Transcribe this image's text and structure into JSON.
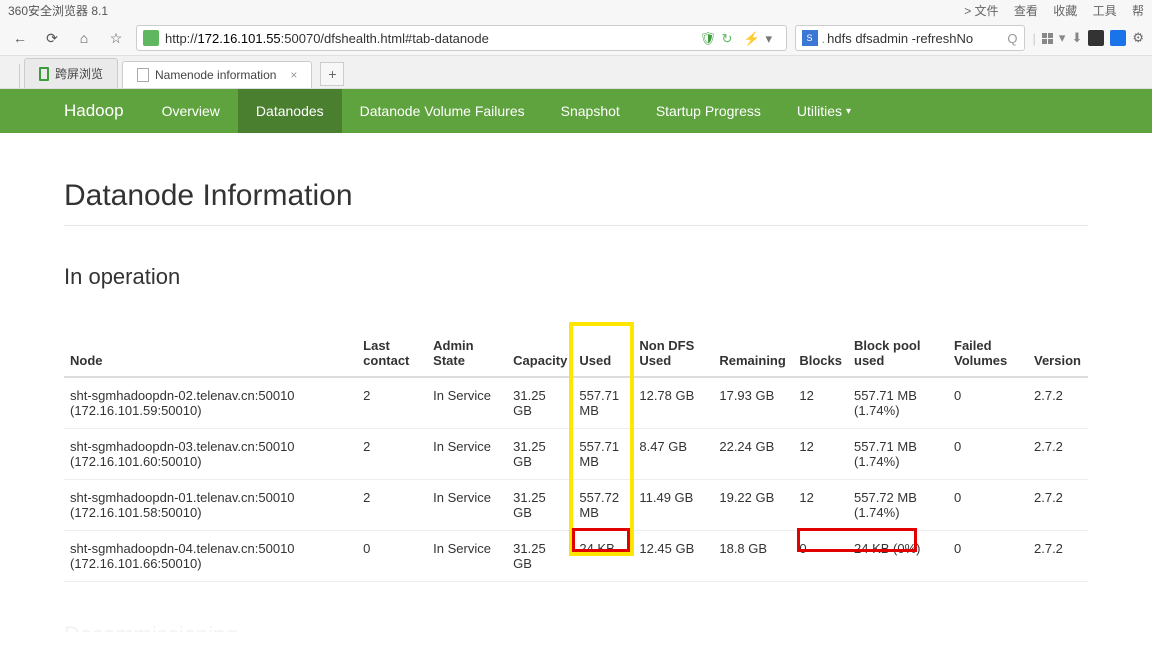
{
  "browser": {
    "title": "360安全浏览器 8.1",
    "right_menu": [
      "> 文件",
      "查看",
      "收藏",
      "工具",
      "帮"
    ],
    "url_prefix": "http://",
    "url_host": "172.16.101.55",
    "url_path": ":50070/dfshealth.html#tab-datanode",
    "search_value": "hdfs dfsadmin -refreshNo",
    "tabs": [
      {
        "label": "跨屏浏览",
        "type": "mobile"
      },
      {
        "label": "Namenode information",
        "type": "doc"
      }
    ]
  },
  "nav": {
    "brand": "Hadoop",
    "items": [
      {
        "label": "Overview",
        "active": false
      },
      {
        "label": "Datanodes",
        "active": true
      },
      {
        "label": "Datanode Volume Failures",
        "active": false
      },
      {
        "label": "Snapshot",
        "active": false
      },
      {
        "label": "Startup Progress",
        "active": false
      },
      {
        "label": "Utilities",
        "active": false,
        "dropdown": true
      }
    ]
  },
  "page": {
    "title": "Datanode Information",
    "section": "In operation",
    "section2": "Decommissioning"
  },
  "table": {
    "headers": [
      "Node",
      "Last contact",
      "Admin State",
      "Capacity",
      "Used",
      "Non DFS Used",
      "Remaining",
      "Blocks",
      "Block pool used",
      "Failed Volumes",
      "Version"
    ],
    "rows": [
      {
        "node": "sht-sgmhadoopdn-02.telenav.cn:50010",
        "node_sub": "(172.16.101.59:50010)",
        "last_contact": "2",
        "admin_state": "In Service",
        "capacity": "31.25 GB",
        "used": "557.71 MB",
        "non_dfs": "12.78 GB",
        "remaining": "17.93 GB",
        "blocks": "12",
        "block_pool": "557.71 MB (1.74%)",
        "failed": "0",
        "version": "2.7.2"
      },
      {
        "node": "sht-sgmhadoopdn-03.telenav.cn:50010",
        "node_sub": "(172.16.101.60:50010)",
        "last_contact": "2",
        "admin_state": "In Service",
        "capacity": "31.25 GB",
        "used": "557.71 MB",
        "non_dfs": "8.47 GB",
        "remaining": "22.24 GB",
        "blocks": "12",
        "block_pool": "557.71 MB (1.74%)",
        "failed": "0",
        "version": "2.7.2"
      },
      {
        "node": "sht-sgmhadoopdn-01.telenav.cn:50010",
        "node_sub": "(172.16.101.58:50010)",
        "last_contact": "2",
        "admin_state": "In Service",
        "capacity": "31.25 GB",
        "used": "557.72 MB",
        "non_dfs": "11.49 GB",
        "remaining": "19.22 GB",
        "blocks": "12",
        "block_pool": "557.72 MB (1.74%)",
        "failed": "0",
        "version": "2.7.2"
      },
      {
        "node": "sht-sgmhadoopdn-04.telenav.cn:50010",
        "node_sub": "(172.16.101.66:50010)",
        "last_contact": "0",
        "admin_state": "In Service",
        "capacity": "31.25 GB",
        "used": "24 KB",
        "non_dfs": "12.45 GB",
        "remaining": "18.8 GB",
        "blocks": "0",
        "block_pool": "24 KB (0%)",
        "failed": "0",
        "version": "2.7.2"
      }
    ]
  }
}
